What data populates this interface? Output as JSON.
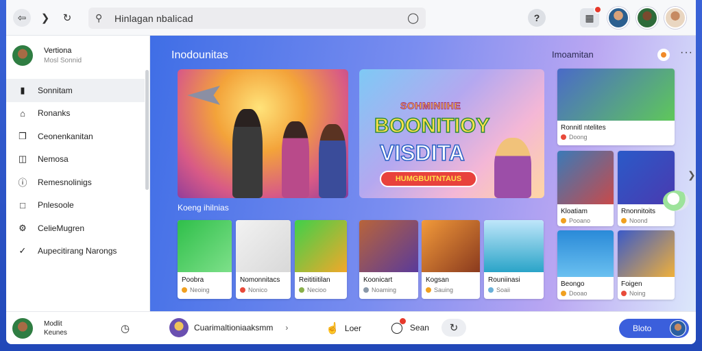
{
  "toolbar": {
    "back_icon": "back-arrow-icon",
    "forward_icon": "chevron-right-icon",
    "reload_icon": "reload-icon",
    "address_value": "Hinlagan nbalicad",
    "search_icon": "search-icon",
    "mic_icon": "microphone-icon",
    "help_icon": "help-icon",
    "calendar_icon": "calendar-icon"
  },
  "sidebar": {
    "profile_name": "Vertiona",
    "profile_sub": "Mosl Sonnid",
    "items": [
      {
        "label": "Sonnitam",
        "icon": "book-icon",
        "active": true
      },
      {
        "label": "Ronanks",
        "icon": "home-icon",
        "active": false
      },
      {
        "label": "Ceonenkanitan",
        "icon": "puzzle-icon",
        "active": false
      },
      {
        "label": "Nemosa",
        "icon": "document-icon",
        "active": false
      },
      {
        "label": "Remesnolinigs",
        "icon": "info-icon",
        "active": false
      },
      {
        "label": "Pnlesoole",
        "icon": "folder-icon",
        "active": false
      },
      {
        "label": "CelieMugren",
        "icon": "gear-icon",
        "active": false
      },
      {
        "label": "Aupecitirang Narongs",
        "icon": "check-circle-icon",
        "active": false
      }
    ]
  },
  "main": {
    "title": "Inodounitas",
    "right_title": "Imoamitan",
    "hero2": {
      "line1": "SOHMINIIHE",
      "line2": "BOONITIOY",
      "line3": "VISDITA",
      "cta": "HUMGBUITNTAUS"
    },
    "sub_title": "Koeng ihilnias",
    "cards": [
      {
        "title": "Poobra",
        "meta": "Neoing",
        "dot": "#f0a020",
        "thumb": "linear-gradient(135deg,#2fbf4a,#7ee08a)"
      },
      {
        "title": "Nomonnitacs",
        "meta": "Nonico",
        "dot": "#e84a3a",
        "thumb": "linear-gradient(135deg,#f2f2f2,#d8d8d8)"
      },
      {
        "title": "Reititiitilan",
        "meta": "Necioo",
        "dot": "#8ab04a",
        "thumb": "linear-gradient(135deg,#3fd04a,#f2a82a)"
      },
      {
        "title": "Koonicart",
        "meta": "Noaming",
        "dot": "#8a98a8",
        "thumb": "linear-gradient(135deg,#b8643a,#5a3a9a)"
      },
      {
        "title": "Kogsan",
        "meta": "Sauing",
        "dot": "#f0a020",
        "thumb": "linear-gradient(135deg,#f29a3a,#8a3a1e)"
      },
      {
        "title": "Rouniinasi",
        "meta": "Soaii",
        "dot": "#6ab0d8",
        "thumb": "linear-gradient(180deg,#bfe6fa,#2aa4c8)"
      }
    ],
    "right_cards": [
      {
        "title": "Ronnitl ntelites",
        "meta": "Doong",
        "dot": "#e84a3a",
        "thumb": "linear-gradient(135deg,#4a6ac8,#5fc85a)"
      },
      {
        "title": "Kloatiam",
        "meta": "Pooano",
        "dot": "#f0a020",
        "thumb": "linear-gradient(135deg,#3a7ab8,#c84a4a)"
      },
      {
        "title": "Rnonnitoits",
        "meta": "Noond",
        "dot": "#f0a020",
        "thumb": "linear-gradient(135deg,#2a5ac8,#4a3ab0)"
      },
      {
        "title": "Beongo",
        "meta": "Dooao",
        "dot": "#f0a020",
        "thumb": "linear-gradient(180deg,#2a8ad8,#6ac0f0)"
      },
      {
        "title": "Foigen",
        "meta": "Noing",
        "dot": "#e84a3a",
        "thumb": "linear-gradient(135deg,#3a5ac8,#f0b03a)"
      }
    ]
  },
  "bottombar": {
    "profile_line1": "Modlit",
    "profile_line2": "Keunes",
    "channel_label": "Cuarimaltioniaaksmm",
    "like_label": "Loer",
    "comment_label": "Sean",
    "cta_label": "Bloto"
  },
  "colors": {
    "accent": "#3b5fdc",
    "background": "#2148b8",
    "badge_red": "#e6392b"
  }
}
